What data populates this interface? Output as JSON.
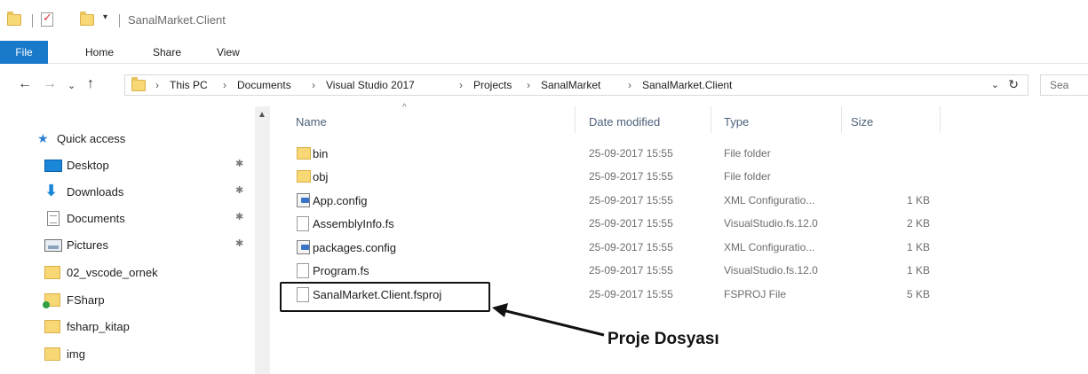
{
  "window": {
    "title": "SanalMarket.Client"
  },
  "ribbon": {
    "tabs": [
      "File",
      "Home",
      "Share",
      "View"
    ]
  },
  "address": {
    "crumbs": [
      "This PC",
      "Documents",
      "Visual Studio 2017",
      "Projects",
      "SanalMarket",
      "SanalMarket.Client"
    ],
    "search_placeholder": "Sea"
  },
  "navpane": {
    "quick_access": "Quick access",
    "items": [
      {
        "label": "Desktop",
        "icon": "desktop-icon",
        "pinned": true
      },
      {
        "label": "Downloads",
        "icon": "download-icon",
        "pinned": true
      },
      {
        "label": "Documents",
        "icon": "documents-icon",
        "pinned": true
      },
      {
        "label": "Pictures",
        "icon": "pictures-icon",
        "pinned": true
      },
      {
        "label": "02_vscode_ornek",
        "icon": "folder-icon",
        "pinned": false
      },
      {
        "label": "FSharp",
        "icon": "folder-sync-icon",
        "pinned": false
      },
      {
        "label": "fsharp_kitap",
        "icon": "folder-icon",
        "pinned": false
      },
      {
        "label": "img",
        "icon": "folder-icon",
        "pinned": false
      }
    ]
  },
  "filelist": {
    "columns": {
      "name": "Name",
      "date": "Date modified",
      "type": "Type",
      "size": "Size"
    },
    "rows": [
      {
        "name": "bin",
        "date": "25-09-2017 15:55",
        "type": "File folder",
        "size": "",
        "icon": "folder-icon"
      },
      {
        "name": "obj",
        "date": "25-09-2017 15:55",
        "type": "File folder",
        "size": "",
        "icon": "folder-icon"
      },
      {
        "name": "App.config",
        "date": "25-09-2017 15:55",
        "type": "XML Configuratio...",
        "size": "1 KB",
        "icon": "config-file-icon"
      },
      {
        "name": "AssemblyInfo.fs",
        "date": "25-09-2017 15:55",
        "type": "VisualStudio.fs.12.0",
        "size": "2 KB",
        "icon": "file-icon"
      },
      {
        "name": "packages.config",
        "date": "25-09-2017 15:55",
        "type": "XML Configuratio...",
        "size": "1 KB",
        "icon": "config-file-icon"
      },
      {
        "name": "Program.fs",
        "date": "25-09-2017 15:55",
        "type": "VisualStudio.fs.12.0",
        "size": "1 KB",
        "icon": "file-icon"
      },
      {
        "name": "SanalMarket.Client.fsproj",
        "date": "25-09-2017 15:55",
        "type": "FSPROJ File",
        "size": "5 KB",
        "icon": "file-icon"
      }
    ]
  },
  "annotation": {
    "text": "Proje Dosyası"
  }
}
